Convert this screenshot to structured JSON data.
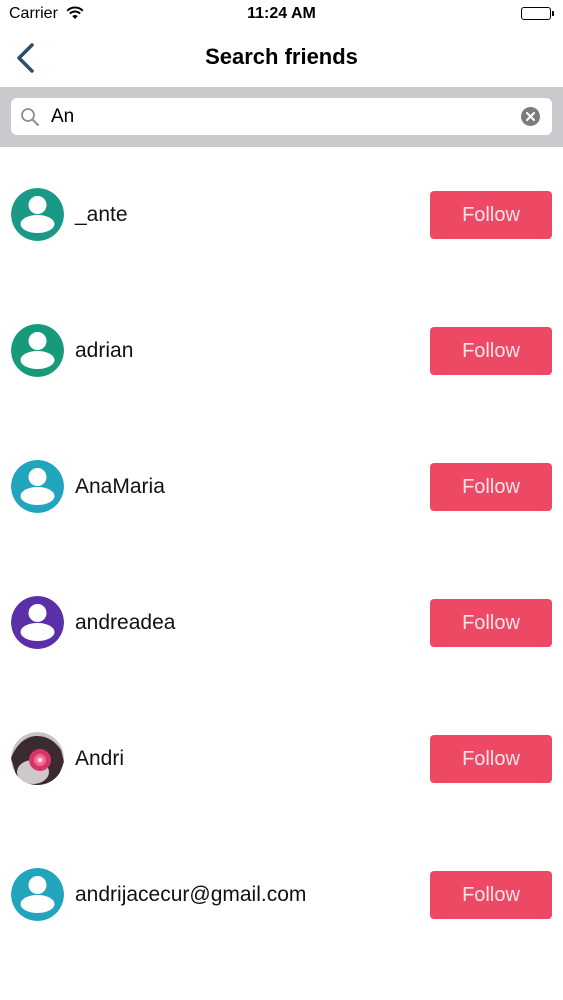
{
  "status_bar": {
    "carrier": "Carrier",
    "time": "11:24 AM"
  },
  "nav": {
    "title": "Search friends",
    "back_icon": "chevron-left-icon"
  },
  "search": {
    "value": "An",
    "search_icon": "magnifier-icon",
    "clear_icon": "clear-icon"
  },
  "results": [
    {
      "username": "_ante",
      "follow_label": "Follow",
      "avatar_color": "#1a9a86"
    },
    {
      "username": "adrian",
      "follow_label": "Follow",
      "avatar_color": "#179a7a"
    },
    {
      "username": "AnaMaria",
      "follow_label": "Follow",
      "avatar_color": "#21a5bd"
    },
    {
      "username": "andreadea",
      "follow_label": "Follow",
      "avatar_color": "#5a2fa8"
    },
    {
      "username": "Andri",
      "follow_label": "Follow",
      "avatar_color": "#d8346a"
    },
    {
      "username": "andrijacecur@gmail.com",
      "follow_label": "Follow",
      "avatar_color": "#21a5bd"
    }
  ],
  "colors": {
    "follow_button": "#ed4964",
    "back_arrow": "#2b4d6e",
    "search_bar_bg": "#c9c9ce"
  }
}
